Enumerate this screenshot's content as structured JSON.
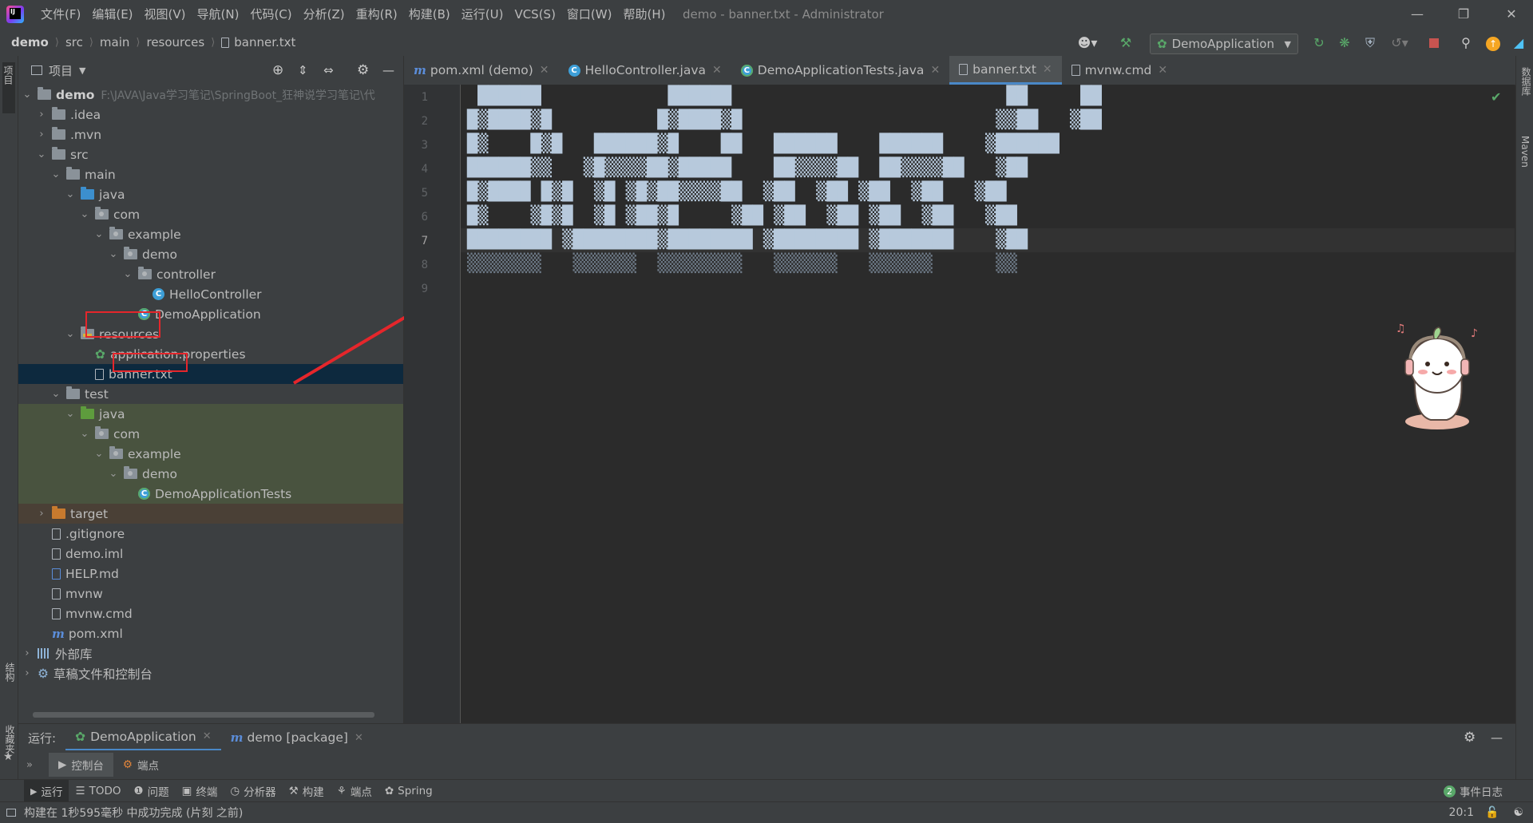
{
  "menu": [
    "文件(F)",
    "编辑(E)",
    "视图(V)",
    "导航(N)",
    "代码(C)",
    "分析(Z)",
    "重构(R)",
    "构建(B)",
    "运行(U)",
    "VCS(S)",
    "窗口(W)",
    "帮助(H)"
  ],
  "window_title": "demo - banner.txt - Administrator",
  "breadcrumb": [
    "demo",
    "src",
    "main",
    "resources",
    "banner.txt"
  ],
  "run_config": "DemoApplication",
  "left_stripe": {
    "project": "项目",
    "structure": "结构",
    "favorites": "收藏夹"
  },
  "right_stripe": {
    "database": "数据库",
    "maven": "Maven"
  },
  "project_panel": {
    "title": "项目"
  },
  "tree": [
    {
      "label": "demo",
      "path": "F:\\JAVA\\Java学习笔记\\SpringBoot_狂神说学习笔记\\代"
    },
    {
      "label": ".idea"
    },
    {
      "label": ".mvn"
    },
    {
      "label": "src"
    },
    {
      "label": "main"
    },
    {
      "label": "java"
    },
    {
      "label": "com"
    },
    {
      "label": "example"
    },
    {
      "label": "demo"
    },
    {
      "label": "controller"
    },
    {
      "label": "HelloController"
    },
    {
      "label": "DemoApplication"
    },
    {
      "label": "resources"
    },
    {
      "label": "application.properties"
    },
    {
      "label": "banner.txt"
    },
    {
      "label": "test"
    },
    {
      "label": "java"
    },
    {
      "label": "com"
    },
    {
      "label": "example"
    },
    {
      "label": "demo"
    },
    {
      "label": "DemoApplicationTests"
    },
    {
      "label": "target"
    },
    {
      "label": ".gitignore"
    },
    {
      "label": "demo.iml"
    },
    {
      "label": "HELP.md"
    },
    {
      "label": "mvnw"
    },
    {
      "label": "mvnw.cmd"
    },
    {
      "label": "pom.xml"
    },
    {
      "label": "外部库"
    },
    {
      "label": "草稿文件和控制台"
    }
  ],
  "editor_tabs": [
    {
      "label": "pom.xml (demo)"
    },
    {
      "label": "HelloController.java"
    },
    {
      "label": "DemoApplicationTests.java"
    },
    {
      "label": "banner.txt"
    },
    {
      "label": "mvnw.cmd"
    }
  ],
  "line_numbers": [
    "1",
    "2",
    "3",
    "4",
    "5",
    "6",
    "7",
    "8",
    "9"
  ],
  "banner_lines": [
    " ██████            ██████                          ██     ██",
    "█▒████▒█          █▒████▒█                        ▒▒██   ▒██",
    "█▒    █▒█   ██████▒█    ██   ██████    ██████    ▒██████",
    "██████▒▒   ▒█▒▒▒▒██▒█████    ██▒▒▒▒██  ██▒▒▒▒██   ▒██",
    "█▒████ █▒█  ▒█ ▒█▒██▒▒▒▒██  ▒██  ▒██ ▒██  ▒██   ▒██",
    "█▒    ▒█▒█  ▒█ ▒██▒█     ▒██ ▒██  ▒██ ▒██  ▒██   ▒██",
    "████████ ▒████████▒████████ ▒████████ ▒███████    ▒██",
    "▒▒▒▒▒▒▒   ▒▒▒▒▒▒  ▒▒▒▒▒▒▒▒   ▒▒▒▒▒▒   ▒▒▒▒▒▒      ▒▒",
    ""
  ],
  "run_panel": {
    "label": "运行:",
    "tabs": [
      {
        "label": "DemoApplication"
      },
      {
        "label": "demo [package]"
      }
    ],
    "sub_tabs": [
      {
        "label": "控制台"
      },
      {
        "label": "端点"
      }
    ]
  },
  "tool_strip": [
    "运行",
    "TODO",
    "问题",
    "终端",
    "分析器",
    "构建",
    "端点",
    "Spring"
  ],
  "event_log": {
    "count": "2",
    "label": "事件日志"
  },
  "status": {
    "message": "构建在 1秒595毫秒 中成功完成 (片刻 之前)",
    "position": "20:1"
  },
  "colors": {
    "accent": "#4a88c7",
    "highlight_box": "#e5262b",
    "selected_row": "#0d293e"
  }
}
